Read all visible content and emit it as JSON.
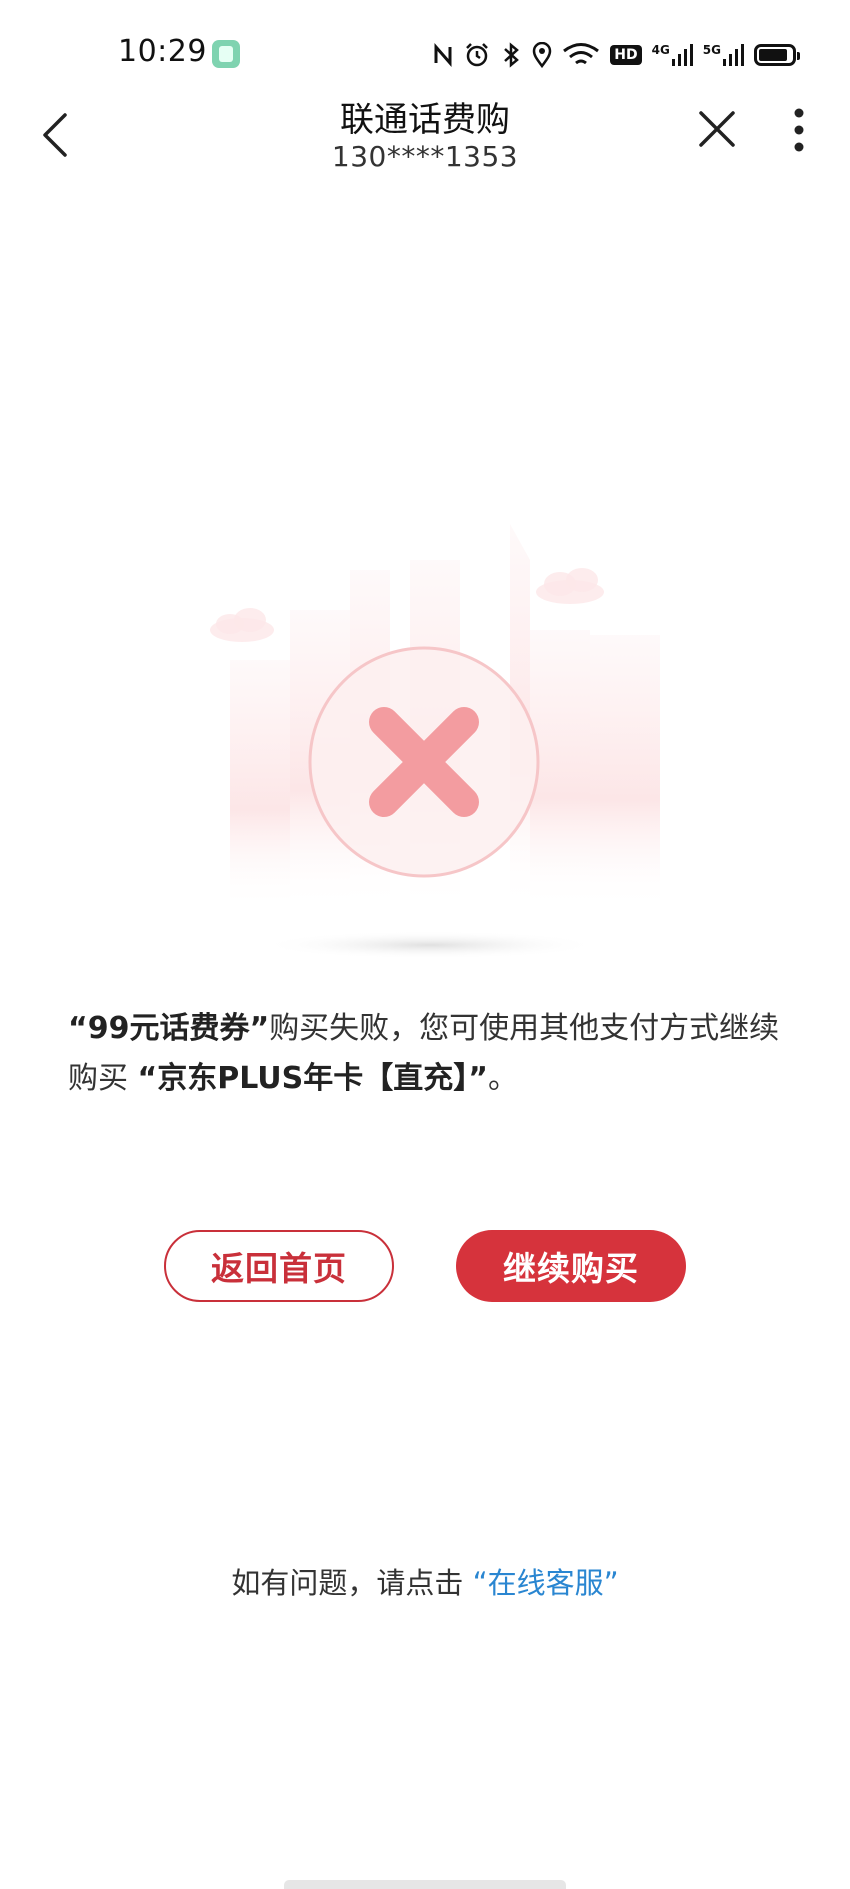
{
  "status_bar": {
    "time": "10:29",
    "app_icon": "notes-app-icon",
    "icons": [
      "nfc-icon",
      "alarm-icon",
      "bluetooth-icon",
      "location-icon",
      "wifi-icon",
      "hd-icon",
      "signal-4g-icon",
      "signal-5g-icon",
      "battery-icon"
    ],
    "hd_label": "HD",
    "signal1_label": "4G",
    "signal2_label": "5G"
  },
  "header": {
    "title": "联通话费购",
    "subtitle": "130****1353",
    "back_icon": "chevron-left-icon",
    "close_icon": "close-icon",
    "more_icon": "more-vertical-icon"
  },
  "illustration": {
    "icon": "payment-failed-icon",
    "accent_color": "#f39ca0"
  },
  "message": {
    "item_name": "“99元话费券”",
    "text_middle": "购买失败，您可使用其他支付方式继续购买",
    "product_name": "“京东PLUS年卡【直充】”",
    "text_end": "。"
  },
  "buttons": {
    "home_label": "返回首页",
    "continue_label": "继续购买"
  },
  "help": {
    "prefix": "如有问题，请点击",
    "link_label": "“在线客服”"
  },
  "colors": {
    "primary_red": "#d6333c",
    "link_blue": "#2a86d1"
  }
}
